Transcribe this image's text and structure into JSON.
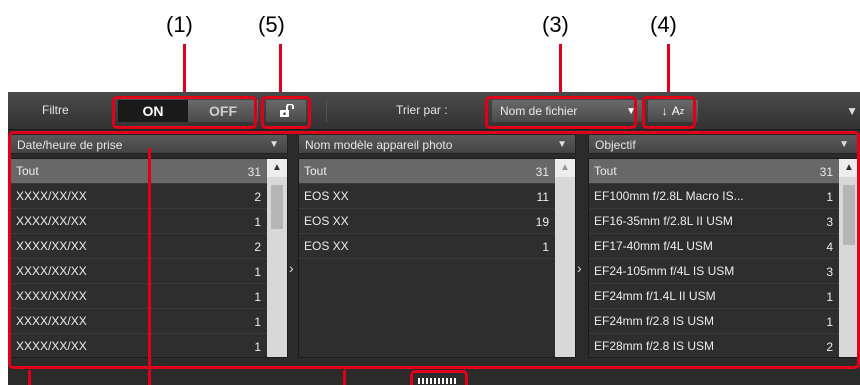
{
  "callouts": [
    "(1)",
    "(5)",
    "(3)",
    "(4)"
  ],
  "toolbar": {
    "filter_label": "Filtre",
    "on_label": "ON",
    "off_label": "OFF",
    "sort_label": "Trier par :",
    "sort_value": "Nom de fichier",
    "order_label": "A",
    "order_sub": "z"
  },
  "columns": [
    {
      "header": "Date/heure de prise",
      "rows": [
        {
          "label": "Tout",
          "count": "31"
        },
        {
          "label": "XXXX/XX/XX",
          "count": "2"
        },
        {
          "label": "XXXX/XX/XX",
          "count": "1"
        },
        {
          "label": "XXXX/XX/XX",
          "count": "2"
        },
        {
          "label": "XXXX/XX/XX",
          "count": "1"
        },
        {
          "label": "XXXX/XX/XX",
          "count": "1"
        },
        {
          "label": "XXXX/XX/XX",
          "count": "1"
        },
        {
          "label": "XXXX/XX/XX",
          "count": "1"
        }
      ]
    },
    {
      "header": "Nom modèle appareil photo",
      "rows": [
        {
          "label": "Tout",
          "count": "31"
        },
        {
          "label": "EOS XX",
          "count": "11"
        },
        {
          "label": "EOS XX",
          "count": "19"
        },
        {
          "label": "EOS XX",
          "count": "1"
        }
      ]
    },
    {
      "header": "Objectif",
      "rows": [
        {
          "label": "Tout",
          "count": "31"
        },
        {
          "label": "EF100mm f/2.8L Macro IS...",
          "count": "1"
        },
        {
          "label": "EF16-35mm f/2.8L II USM",
          "count": "3"
        },
        {
          "label": "EF17-40mm f/4L USM",
          "count": "4"
        },
        {
          "label": "EF24-105mm f/4L IS USM",
          "count": "3"
        },
        {
          "label": "EF24mm f/1.4L II USM",
          "count": "1"
        },
        {
          "label": "EF24mm f/2.8 IS USM",
          "count": "1"
        },
        {
          "label": "EF28mm f/2.8 IS USM",
          "count": "2"
        }
      ]
    }
  ],
  "colors": {
    "annotation": "#e0001a",
    "panel": "#2b2b2b",
    "selected_row": "#686868"
  }
}
